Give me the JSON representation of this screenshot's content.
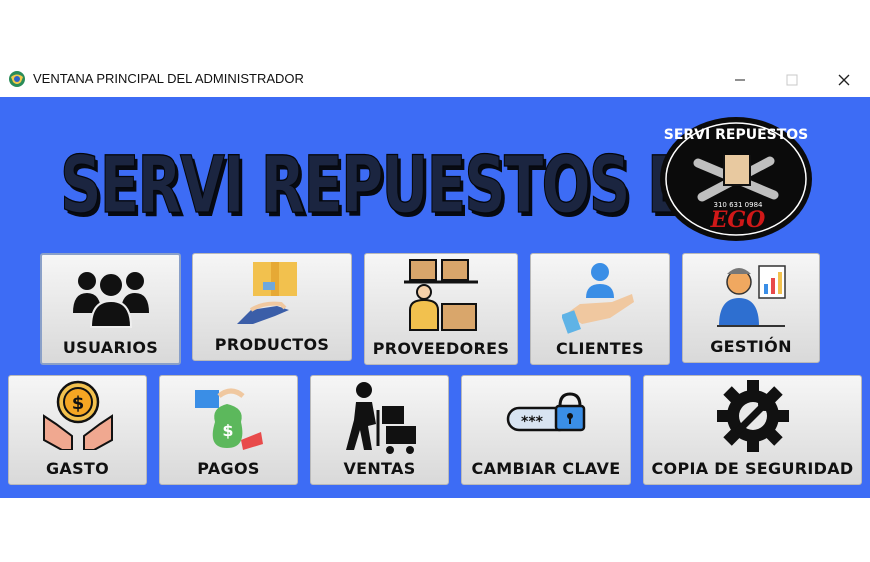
{
  "window": {
    "title": "VENTANA PRINCIPAL DEL ADMINISTRADOR"
  },
  "banner": {
    "title": "SERVI REPUESTOS EGO"
  },
  "logo": {
    "top_text": "SERVI REPUESTOS",
    "phone": "310 631 0984",
    "brand": "EGO"
  },
  "buttons": [
    {
      "label": "USUARIOS",
      "icon": "users-icon"
    },
    {
      "label": "PRODUCTOS",
      "icon": "box-hand-icon"
    },
    {
      "label": "PROVEEDORES",
      "icon": "supplier-boxes-icon"
    },
    {
      "label": "CLIENTES",
      "icon": "client-hand-icon"
    },
    {
      "label": "GESTIÓN",
      "icon": "manager-chart-icon"
    },
    {
      "label": "GASTO",
      "icon": "coin-hands-icon"
    },
    {
      "label": "PAGOS",
      "icon": "money-bag-icon"
    },
    {
      "label": "VENTAS",
      "icon": "delivery-cart-icon"
    },
    {
      "label": "CAMBIAR CLAVE",
      "icon": "password-lock-icon"
    },
    {
      "label": "COPIA DE SEGURIDAD",
      "icon": "backup-gear-icon"
    }
  ]
}
